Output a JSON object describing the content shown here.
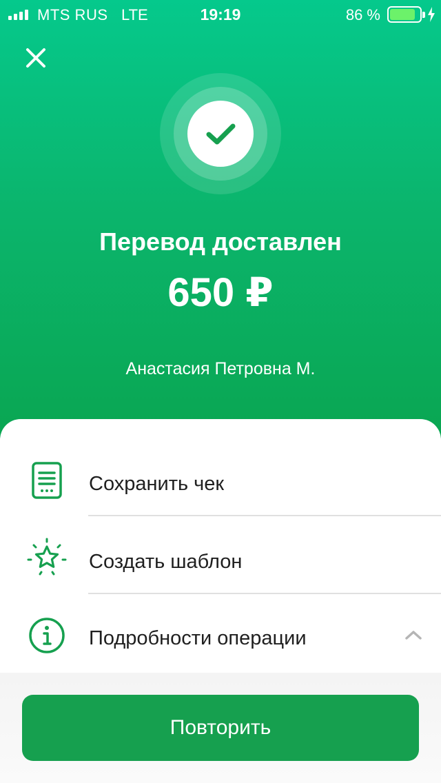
{
  "status_bar": {
    "carrier": "MTS RUS",
    "network": "LTE",
    "time": "19:19",
    "battery_percent": "86 %",
    "battery_level": 0.86
  },
  "header": {
    "close_icon": "close-icon",
    "success_icon": "check-icon",
    "title": "Перевод доставлен",
    "amount": "650 ₽",
    "recipient": "Анастасия Петровна М."
  },
  "actions": [
    {
      "label": "Сохранить чек",
      "icon": "receipt-icon"
    },
    {
      "label": "Создать шаблон",
      "icon": "star-icon"
    },
    {
      "label": "Подробности операции",
      "icon": "info-icon",
      "expand_icon": "chevron-up-icon"
    }
  ],
  "footer": {
    "repeat_label": "Повторить"
  },
  "colors": {
    "brand_green": "#16a04f",
    "gradient_top": "#05c98c",
    "gradient_bottom": "#0aa550"
  }
}
